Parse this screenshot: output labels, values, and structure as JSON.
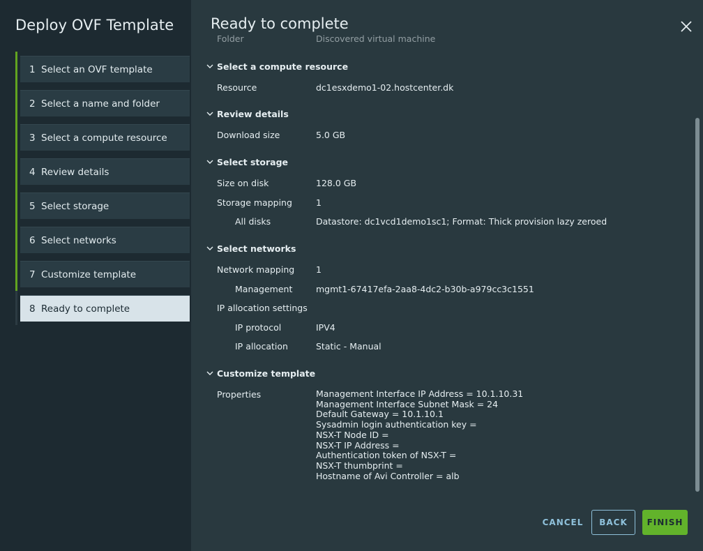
{
  "background": {
    "faint_text": "..."
  },
  "wizard": {
    "title": "Deploy OVF Template",
    "steps": [
      {
        "num": "1",
        "label": "Select an OVF template"
      },
      {
        "num": "2",
        "label": "Select a name and folder"
      },
      {
        "num": "3",
        "label": "Select a compute resource"
      },
      {
        "num": "4",
        "label": "Review details"
      },
      {
        "num": "5",
        "label": "Select storage"
      },
      {
        "num": "6",
        "label": "Select networks"
      },
      {
        "num": "7",
        "label": "Customize template"
      },
      {
        "num": "8",
        "label": "Ready to complete"
      }
    ],
    "active_step": 8
  },
  "page": {
    "title": "Ready to complete",
    "clipped_row": {
      "label": "Folder",
      "value": "Discovered virtual machine"
    },
    "sections": {
      "compute": {
        "title": "Select a compute resource",
        "resource_label": "Resource",
        "resource_value": "dc1esxdemo1-02.hostcenter.dk"
      },
      "review": {
        "title": "Review details",
        "download_label": "Download size",
        "download_value": "5.0 GB"
      },
      "storage": {
        "title": "Select storage",
        "size_label": "Size on disk",
        "size_value": "128.0 GB",
        "mapping_label": "Storage mapping",
        "mapping_value": "1",
        "all_disks_label": "All disks",
        "all_disks_value": "Datastore: dc1vcd1demo1sc1; Format: Thick provision lazy zeroed"
      },
      "networks": {
        "title": "Select networks",
        "mapping_label": "Network mapping",
        "mapping_value": "1",
        "management_label": "Management",
        "management_value": "mgmt1-67417efa-2aa8-4dc2-b30b-a979cc3c1551",
        "ip_settings_label": "IP allocation settings",
        "ip_protocol_label": "IP protocol",
        "ip_protocol_value": "IPV4",
        "ip_allocation_label": "IP allocation",
        "ip_allocation_value": "Static - Manual"
      },
      "customize": {
        "title": "Customize template",
        "properties_label": "Properties",
        "properties": [
          "Management Interface IP Address = 10.1.10.31",
          "Management Interface Subnet Mask = 24",
          "Default Gateway = 10.1.10.1",
          "Sysadmin login authentication key =",
          "NSX-T Node ID =",
          "NSX-T IP Address =",
          "Authentication token of NSX-T =",
          "NSX-T thumbprint =",
          "Hostname of Avi Controller = alb"
        ]
      }
    }
  },
  "footer": {
    "cancel": "CANCEL",
    "back": "BACK",
    "finish": "FINISH"
  },
  "colors": {
    "accent_green": "#62a420",
    "finish_green": "#62b32b",
    "link_blue": "#8fc1db"
  }
}
